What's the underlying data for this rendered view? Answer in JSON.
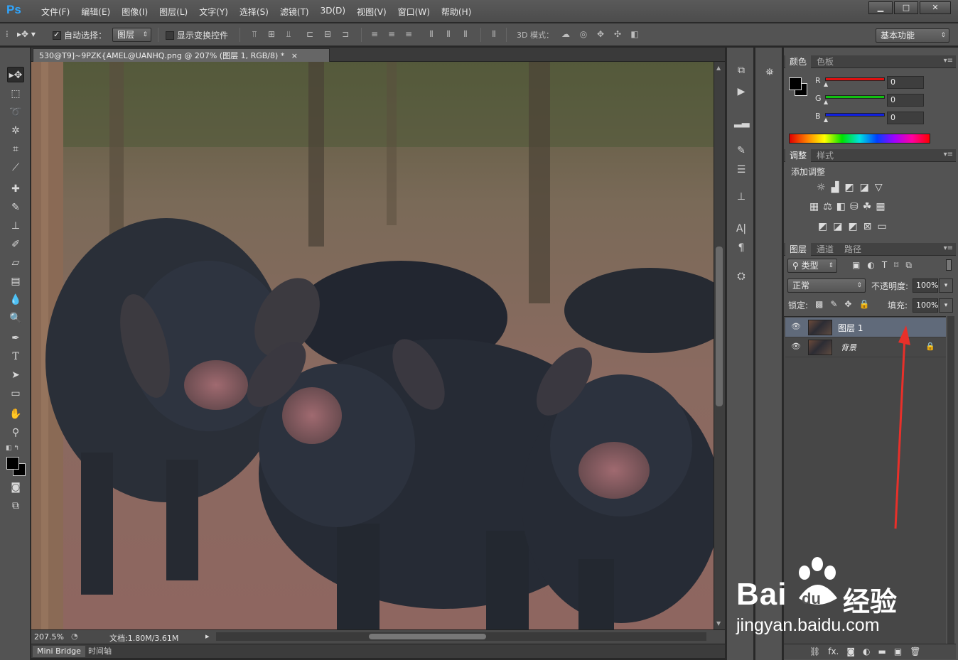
{
  "app": {
    "logo": "Ps"
  },
  "menu": [
    "文件(F)",
    "编辑(E)",
    "图像(I)",
    "图层(L)",
    "文字(Y)",
    "选择(S)",
    "滤镜(T)",
    "3D(D)",
    "视图(V)",
    "窗口(W)",
    "帮助(H)"
  ],
  "window_controls": {
    "minimize": "▁",
    "maximize": "□",
    "close": "✕"
  },
  "options": {
    "auto_select_label": "自动选择：",
    "auto_select_value": "图层",
    "show_transform_label": "显示变换控件",
    "mode_3d_label": "3D 模式：",
    "workspace": "基本功能"
  },
  "document": {
    "tab_title": "530@T9]~9PZK{AMEL@UANHQ.png @ 207% (图层 1, RGB/8) *",
    "tab_close": "×",
    "zoom": "207.5%",
    "doc_size": "文档:1.80M/3.61M"
  },
  "bottom_tabs": [
    "Mini Bridge",
    "时间轴"
  ],
  "color_panel": {
    "tabs": [
      "颜色",
      "色板"
    ],
    "channels": [
      {
        "label": "R",
        "value": "0",
        "color": "#e01010"
      },
      {
        "label": "G",
        "value": "0",
        "color": "#10c010"
      },
      {
        "label": "B",
        "value": "0",
        "color": "#1020e0"
      }
    ]
  },
  "adjust_panel": {
    "tabs": [
      "调整",
      "样式"
    ],
    "add_label": "添加调整"
  },
  "layers_panel": {
    "tabs": [
      "图层",
      "通道",
      "路径"
    ],
    "filter_kind": "类型",
    "blend_mode": "正常",
    "opacity_label": "不透明度:",
    "opacity_value": "100%",
    "lock_label": "锁定:",
    "fill_label": "填充:",
    "fill_value": "100%",
    "layers": [
      {
        "name": "图层 1",
        "selected": true,
        "locked": false
      },
      {
        "name": "背景",
        "selected": false,
        "locked": true
      }
    ],
    "footer_fx": "fx."
  },
  "watermark": {
    "brand": "Bai",
    "brand2": "du",
    "product": "经验",
    "url": "jingyan.baidu.com"
  },
  "colors": {
    "accent": "#30a6ff",
    "arrow": "#e8302a",
    "selected_layer": "#606a7a"
  }
}
